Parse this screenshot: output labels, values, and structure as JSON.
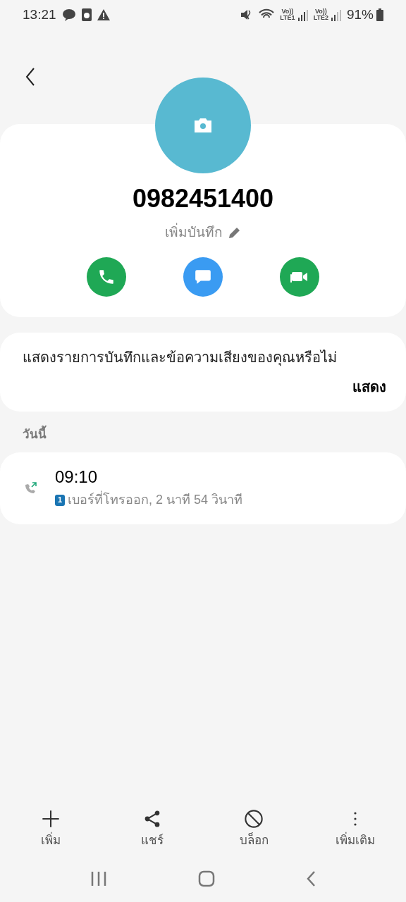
{
  "status_bar": {
    "time": "13:21",
    "sims": [
      {
        "top": "Vo))",
        "bottom": "LTE1"
      },
      {
        "top": "Vo))",
        "bottom": "LTE2"
      }
    ],
    "battery": "91%"
  },
  "contact": {
    "number": "0982451400",
    "note_label": "เพิ่มบันทึก"
  },
  "actions": [
    {
      "kind": "call"
    },
    {
      "kind": "message"
    },
    {
      "kind": "video"
    }
  ],
  "recording_prompt": {
    "text": "แสดงรายการบันทึกและข้อความเสียงของคุณหรือไม่",
    "button": "แสดง"
  },
  "history": {
    "heading": "วันนี้",
    "entries": [
      {
        "time": "09:10",
        "sim": "1",
        "detail": "เบอร์ที่โทรออก, 2 นาที 54 วินาที"
      }
    ]
  },
  "bottom_actions": [
    {
      "kind": "add",
      "label": "เพิ่ม"
    },
    {
      "kind": "share",
      "label": "แชร์"
    },
    {
      "kind": "block",
      "label": "บล็อก"
    },
    {
      "kind": "more",
      "label": "เพิ่มเติม"
    }
  ]
}
